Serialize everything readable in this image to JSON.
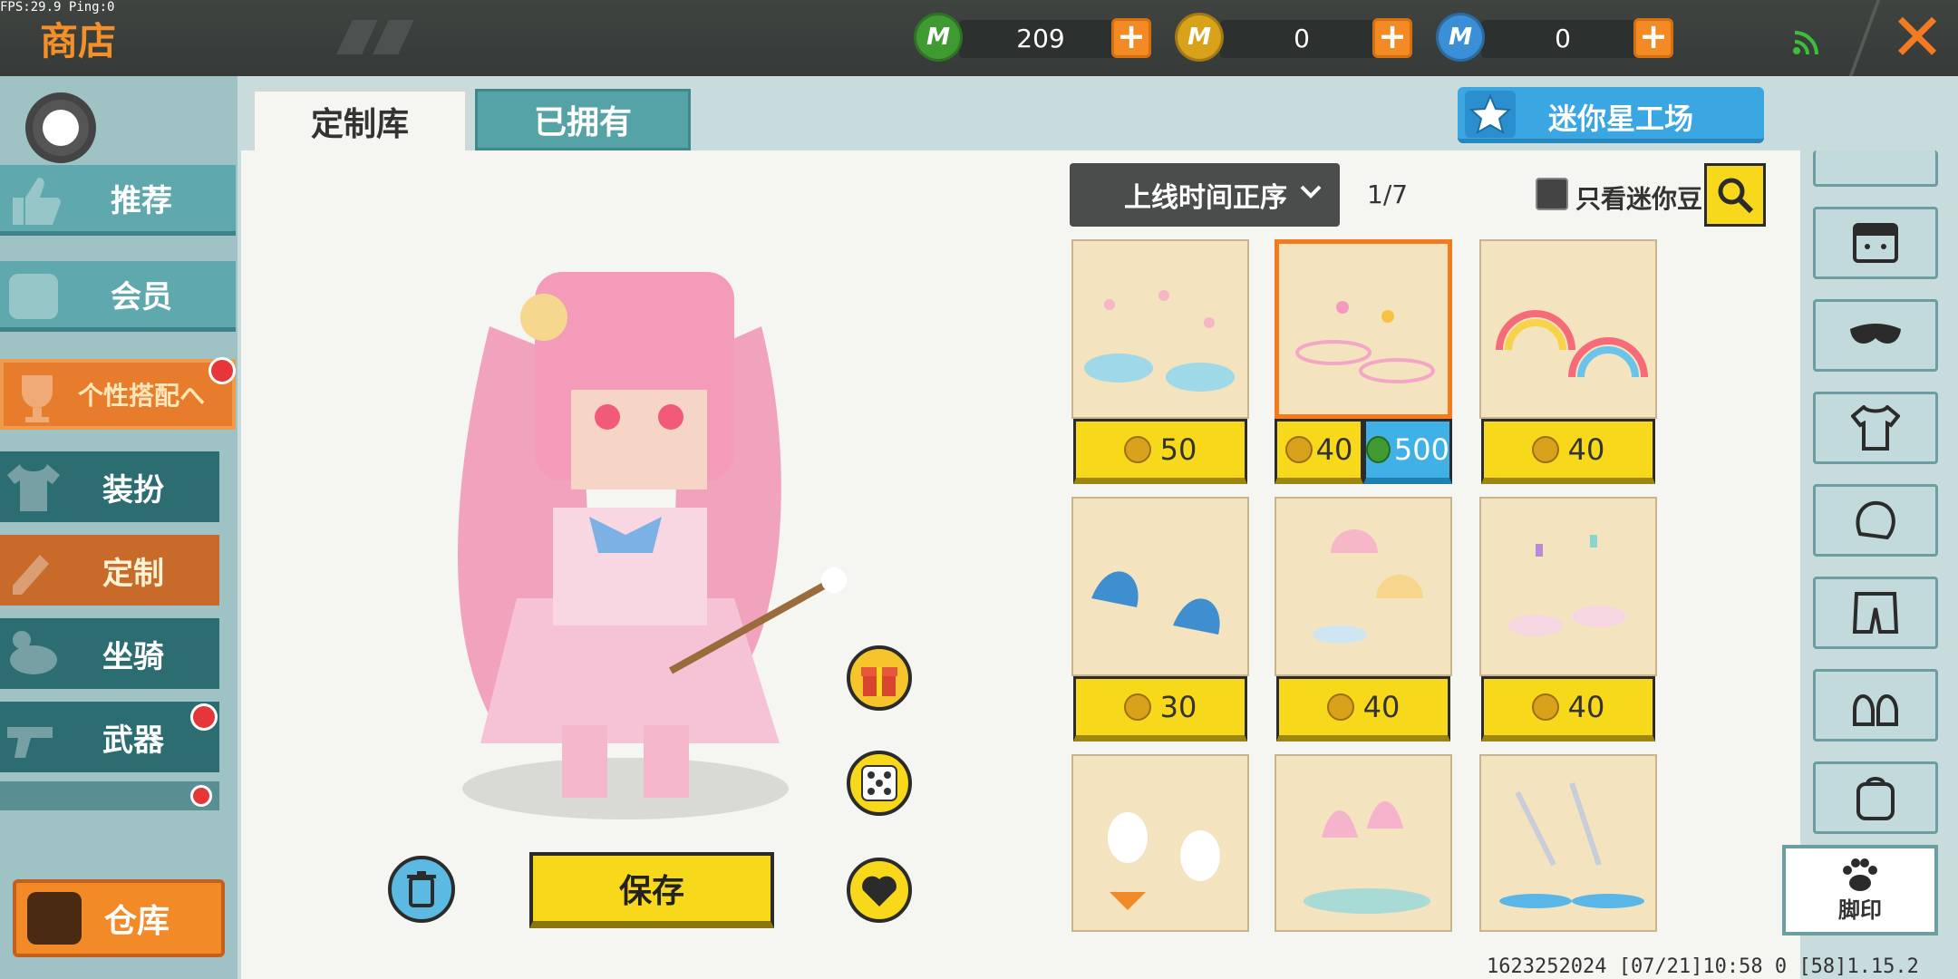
{
  "debug": {
    "fps": "FPS:29.9  Ping:0"
  },
  "header": {
    "title": "商店"
  },
  "currencies": [
    {
      "name": "mini-bean",
      "value": "209",
      "color": "#3f9a32"
    },
    {
      "name": "gold-coin",
      "value": "0",
      "color": "#d9a21b"
    },
    {
      "name": "mini-coin",
      "value": "0",
      "color": "#3a8fd6"
    }
  ],
  "sidebar": {
    "items": [
      {
        "label": "推荐"
      },
      {
        "label": "会员"
      },
      {
        "label": "个性搭配へ"
      },
      {
        "label": "装扮"
      },
      {
        "label": "定制"
      },
      {
        "label": "坐骑"
      },
      {
        "label": "武器"
      }
    ],
    "warehouse_label": "仓库"
  },
  "tabs": [
    {
      "label": "定制库",
      "active": true
    },
    {
      "label": "已拥有",
      "active": false
    }
  ],
  "studio_button": "迷你星工场",
  "sort": {
    "label": "上线时间正序"
  },
  "pagination": "1/7",
  "filter_label": "只看迷你豆",
  "save_label": "保存",
  "items": [
    {
      "prices": [
        {
          "currency": "coin",
          "value": "50"
        }
      ]
    },
    {
      "prices": [
        {
          "currency": "coin",
          "value": "40"
        },
        {
          "currency": "bean",
          "value": "500"
        }
      ],
      "selected": true
    },
    {
      "prices": [
        {
          "currency": "coin",
          "value": "40"
        }
      ]
    },
    {
      "prices": [
        {
          "currency": "coin",
          "value": "30"
        }
      ]
    },
    {
      "prices": [
        {
          "currency": "coin",
          "value": "40"
        }
      ]
    },
    {
      "prices": [
        {
          "currency": "coin",
          "value": "40"
        }
      ]
    }
  ],
  "rail": {
    "footprint_label": "脚印"
  },
  "footer": {
    "info": "1623252024  [07/21]10:58 0  [58]1.15.2"
  }
}
